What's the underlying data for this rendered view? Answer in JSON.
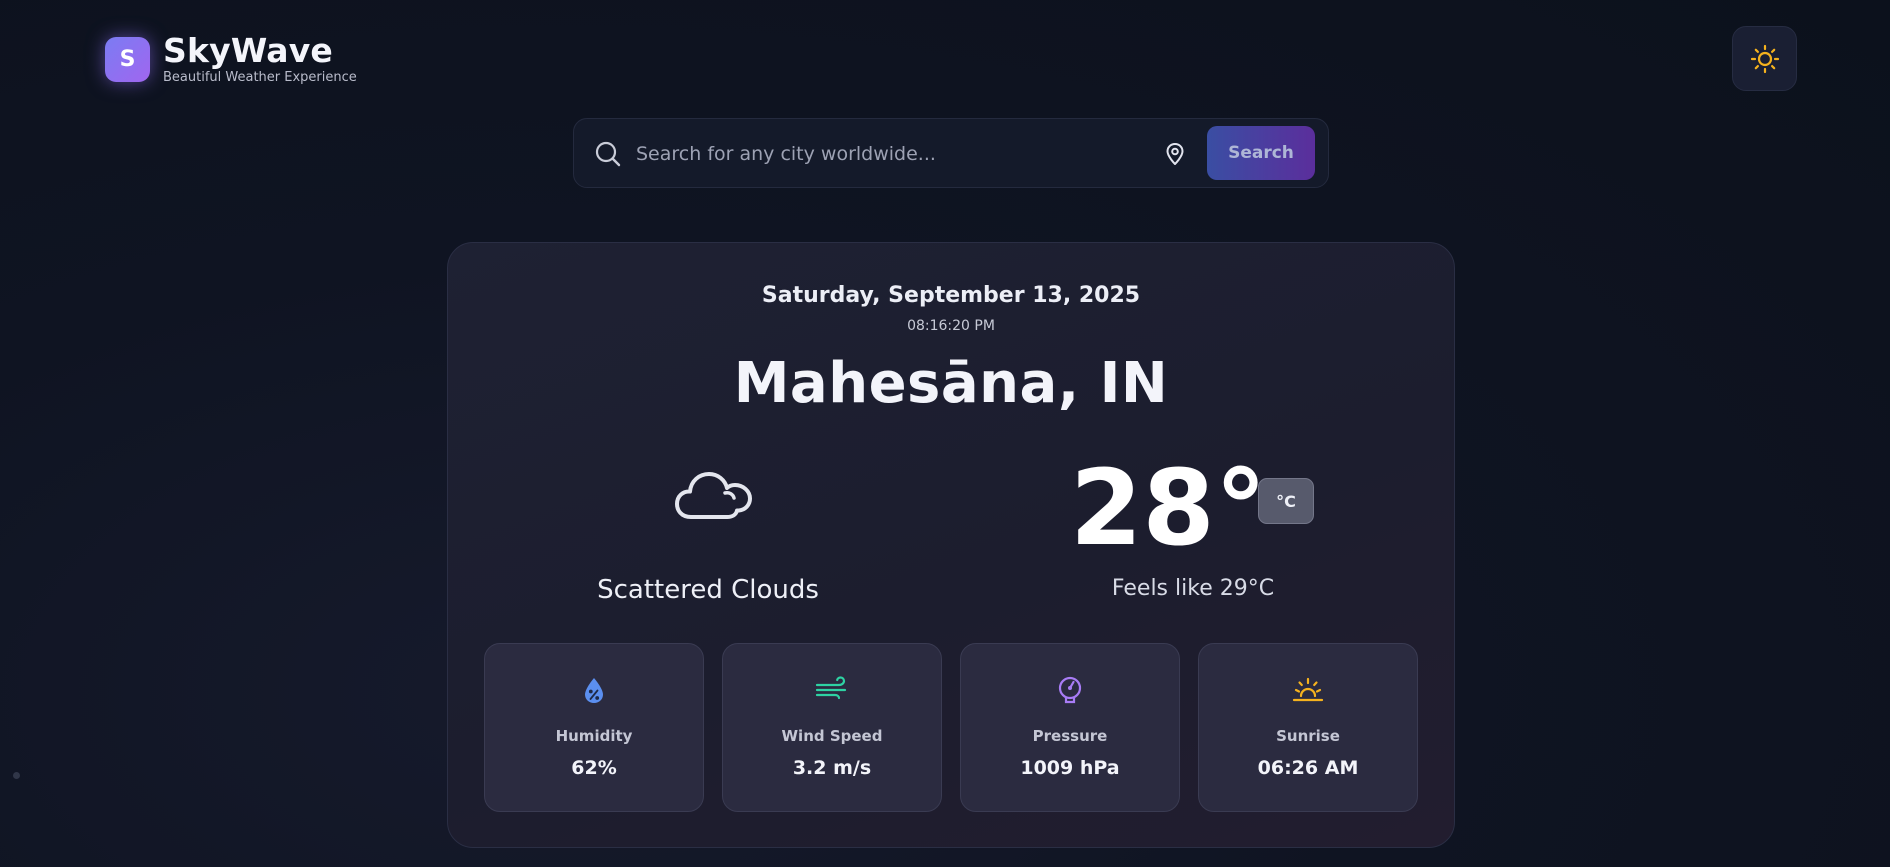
{
  "app": {
    "logo_letter": "S",
    "title": "SkyWave",
    "subtitle": "Beautiful Weather Experience",
    "theme_toggle_icon": "sun-icon"
  },
  "search": {
    "placeholder": "Search for any city worldwide...",
    "value": "",
    "location_icon": "map-pin-icon",
    "button_label": "Search"
  },
  "weather": {
    "date": "Saturday, September 13, 2025",
    "time": "08:16:20 PM",
    "location": "Mahesāna, IN",
    "condition_icon": "cloud-icon",
    "condition": "Scattered Clouds",
    "temperature": "28°",
    "unit_button": "°C",
    "feels_like": "Feels like 29°C"
  },
  "stats": [
    {
      "icon": "humidity-drop-icon",
      "label": "Humidity",
      "value": "62%",
      "color": "#5b8ff0"
    },
    {
      "icon": "wind-icon",
      "label": "Wind Speed",
      "value": "3.2 m/s",
      "color": "#2ed3a3"
    },
    {
      "icon": "gauge-icon",
      "label": "Pressure",
      "value": "1009 hPa",
      "color": "#a87cf5"
    },
    {
      "icon": "sunrise-icon",
      "label": "Sunrise",
      "value": "06:26 AM",
      "color": "#f5b21e"
    }
  ],
  "colors": {
    "background": "#0f1422",
    "card": "#1e2133",
    "accent_gradient_start": "#3a4ea3",
    "accent_gradient_end": "#5b2e9c",
    "logo_gradient_start": "#7b7cf2",
    "logo_gradient_end": "#a066f0",
    "sun_icon": "#f5b21e"
  }
}
